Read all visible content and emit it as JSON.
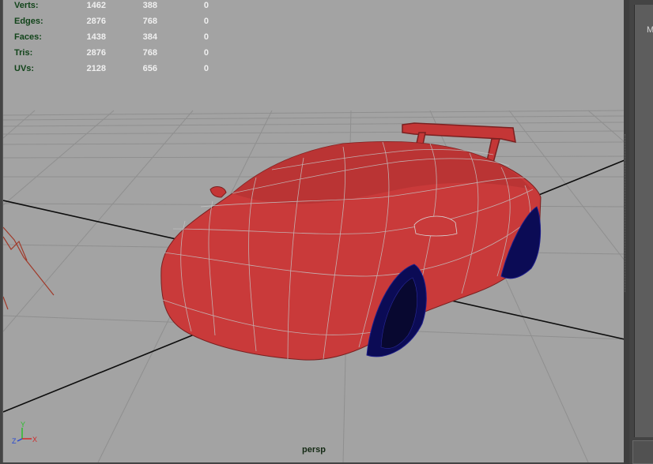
{
  "heads_up": {
    "rows": [
      {
        "label": "Verts:",
        "v1": "1462",
        "v2": "388",
        "v3": "0"
      },
      {
        "label": "Edges:",
        "v1": "2876",
        "v2": "768",
        "v3": "0"
      },
      {
        "label": "Faces:",
        "v1": "1438",
        "v2": "384",
        "v3": "0"
      },
      {
        "label": "Tris:",
        "v1": "2876",
        "v2": "768",
        "v3": "0"
      },
      {
        "label": "UVs:",
        "v1": "2128",
        "v2": "656",
        "v3": "0"
      }
    ]
  },
  "viewport": {
    "camera_label": "persp",
    "axis_labels": {
      "y": "Y",
      "z": "Z",
      "x": "X"
    }
  },
  "right_panel": {
    "text": "M"
  },
  "colors": {
    "viewport_bg": "#a3a3a3",
    "grid": "#8f8f8f",
    "body": "#c93a3a",
    "wireframe": "#b8b8b8",
    "wheel": "#0b0b55",
    "stats_label": "#12441a",
    "stats_value": "#efefef"
  },
  "icons": [
    "axis-gizmo-icon"
  ]
}
